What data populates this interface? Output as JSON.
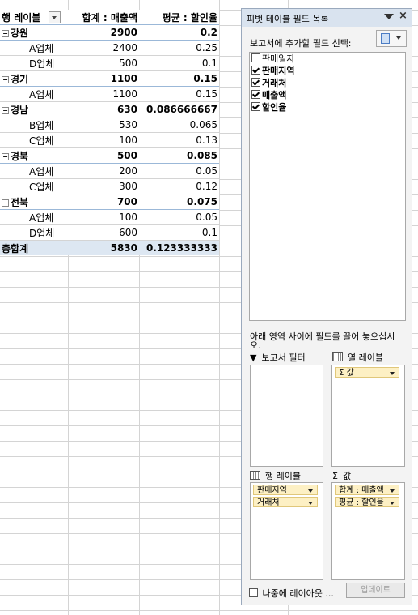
{
  "pivot": {
    "headers": {
      "row_label": "행 레이블",
      "sum_label": "합계 : 매출액",
      "avg_label": "평균 : 할인율"
    },
    "groups": [
      {
        "name": "강원",
        "sum": "2900",
        "avg": "0.2",
        "items": [
          {
            "name": "A업체",
            "sum": "2400",
            "avg": "0.25"
          },
          {
            "name": "D업체",
            "sum": "500",
            "avg": "0.1"
          }
        ]
      },
      {
        "name": "경기",
        "sum": "1100",
        "avg": "0.15",
        "items": [
          {
            "name": "A업체",
            "sum": "1100",
            "avg": "0.15"
          }
        ]
      },
      {
        "name": "경남",
        "sum": "630",
        "avg": "0.086666667",
        "items": [
          {
            "name": "B업체",
            "sum": "530",
            "avg": "0.065"
          },
          {
            "name": "C업체",
            "sum": "100",
            "avg": "0.13"
          }
        ]
      },
      {
        "name": "경북",
        "sum": "500",
        "avg": "0.085",
        "items": [
          {
            "name": "A업체",
            "sum": "200",
            "avg": "0.05"
          },
          {
            "name": "C업체",
            "sum": "300",
            "avg": "0.12"
          }
        ]
      },
      {
        "name": "전북",
        "sum": "700",
        "avg": "0.075",
        "items": [
          {
            "name": "A업체",
            "sum": "100",
            "avg": "0.05"
          },
          {
            "name": "D업체",
            "sum": "600",
            "avg": "0.1"
          }
        ]
      }
    ],
    "total": {
      "label": "총합계",
      "sum": "5830",
      "avg": "0.123333333"
    },
    "collapse_symbol": "⊟"
  },
  "pane": {
    "title": "피벗 테이블 필드 목록",
    "close": "×",
    "fields_label": "보고서에 추가할 필드 선택:",
    "fields": [
      {
        "label": "판매일자",
        "checked": false
      },
      {
        "label": "판매지역",
        "checked": true
      },
      {
        "label": "거래처",
        "checked": true
      },
      {
        "label": "매출액",
        "checked": true
      },
      {
        "label": "할인율",
        "checked": true
      }
    ],
    "drag_hint": "아래 영역 사이에 필드를 끌어 놓으십시오.",
    "areas": {
      "report_filter": "보고서 필터",
      "column_labels": "열 레이블",
      "row_labels": "행 레이블",
      "values": "값",
      "sigma": "Σ",
      "filter_icon": "filter-icon"
    },
    "column_chips": [
      "Σ 값"
    ],
    "row_chips": [
      "판매지역",
      "거래처"
    ],
    "value_chips": [
      "합계 : 매출액",
      "평균 : 할인율"
    ],
    "defer_label": "나중에 레이아웃 ...",
    "update_label": "업데이트"
  }
}
